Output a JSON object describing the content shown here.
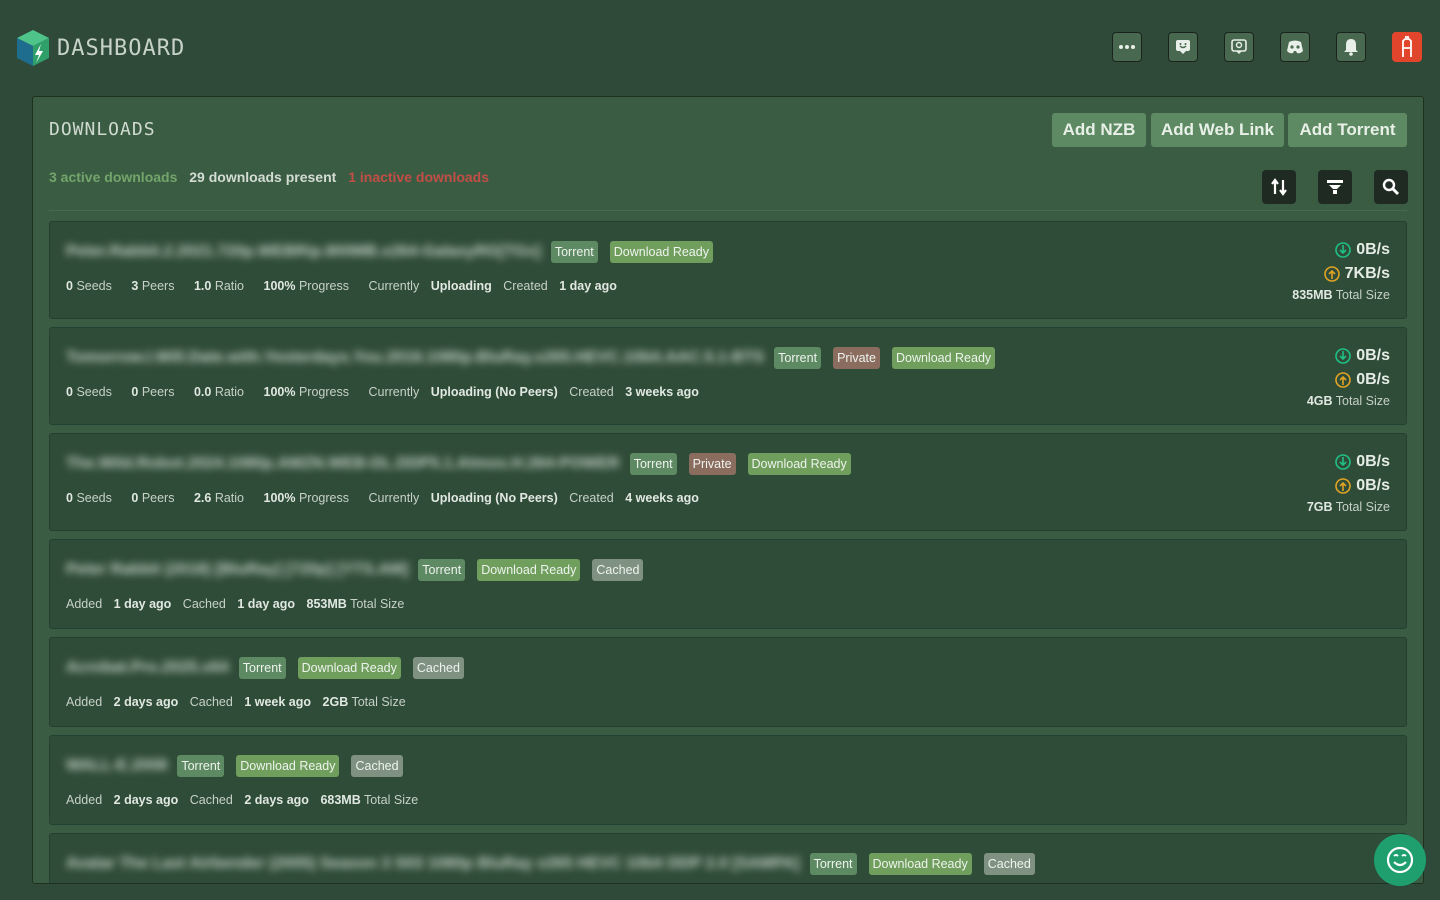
{
  "app": {
    "title": "DASHBOARD"
  },
  "header": {
    "buttons": [
      {
        "name": "more-icon"
      },
      {
        "name": "chat-bubble-icon"
      },
      {
        "name": "ideas-icon"
      },
      {
        "name": "discord-icon"
      },
      {
        "name": "bell-icon"
      },
      {
        "name": "avatar"
      }
    ]
  },
  "downloads": {
    "title": "DOWNLOADS",
    "add_nzb": "Add NZB",
    "add_web_link": "Add Web Link",
    "add_torrent": "Add Torrent",
    "summary": {
      "active": "3 active downloads",
      "present": "29 downloads present",
      "inactive": "1 inactive downloads"
    },
    "tools": [
      "sort-icon",
      "filter-icon",
      "search-icon"
    ],
    "items": [
      {
        "name": "Peter.Rabbit.2.2021.720p.WEBRip.800MB.x264-GalaxyRG[TGx]",
        "badges": [
          "Torrent",
          "Download Ready"
        ],
        "meta": {
          "seeds": "0",
          "seeds_label": "Seeds",
          "peers": "3",
          "peers_label": "Peers",
          "ratio": "1.0",
          "ratio_label": "Ratio",
          "progress": "100%",
          "progress_label": "Progress",
          "status_label": "Currently",
          "status": "Uploading",
          "created_label": "Created",
          "created": "1 day ago"
        },
        "down_speed": "0B/s",
        "up_speed": "7KB/s",
        "size": "835MB",
        "size_label": "Total Size"
      },
      {
        "name": "Tomorrow.I.Will.Date.with.Yesterdays.You.2016.1080p.BluRay.x265.HEVC.10bit.AAC.5.1-BTS",
        "badges": [
          "Torrent",
          "Private",
          "Download Ready"
        ],
        "meta": {
          "seeds": "0",
          "seeds_label": "Seeds",
          "peers": "0",
          "peers_label": "Peers",
          "ratio": "0.0",
          "ratio_label": "Ratio",
          "progress": "100%",
          "progress_label": "Progress",
          "status_label": "Currently",
          "status": "Uploading (No Peers)",
          "created_label": "Created",
          "created": "3 weeks ago"
        },
        "down_speed": "0B/s",
        "up_speed": "0B/s",
        "size": "4GB",
        "size_label": "Total Size"
      },
      {
        "name": "The.Wild.Robot.2024.1080p.AMZN.WEB-DL.DDP5.1.Atmos.H.264-POWER",
        "badges": [
          "Torrent",
          "Private",
          "Download Ready"
        ],
        "meta": {
          "seeds": "0",
          "seeds_label": "Seeds",
          "peers": "0",
          "peers_label": "Peers",
          "ratio": "2.6",
          "ratio_label": "Ratio",
          "progress": "100%",
          "progress_label": "Progress",
          "status_label": "Currently",
          "status": "Uploading (No Peers)",
          "created_label": "Created",
          "created": "4 weeks ago"
        },
        "down_speed": "0B/s",
        "up_speed": "0B/s",
        "size": "7GB",
        "size_label": "Total Size"
      },
      {
        "name": "Peter Rabbit (2018) [BluRay] [720p] [YTS.AM]",
        "badges": [
          "Torrent",
          "Download Ready",
          "Cached"
        ],
        "added_label": "Added",
        "added": "1 day ago",
        "cached_label": "Cached",
        "cached": "1 day ago",
        "size": "853MB",
        "size_label": "Total Size"
      },
      {
        "name": "Acrobat.Pro.2025.x64",
        "badges": [
          "Torrent",
          "Download Ready",
          "Cached"
        ],
        "added_label": "Added",
        "added": "2 days ago",
        "cached_label": "Cached",
        "cached": "1 week ago",
        "size": "2GB",
        "size_label": "Total Size"
      },
      {
        "name": "WALL-E.2008",
        "badges": [
          "Torrent",
          "Download Ready",
          "Cached"
        ],
        "added_label": "Added",
        "added": "2 days ago",
        "cached_label": "Cached",
        "cached": "2 days ago",
        "size": "683MB",
        "size_label": "Total Size"
      },
      {
        "name": "Avatar The Last Airbender (2005) Season 3 S03 1080p BluRay x265 HEVC 10bit DDP 2.0 [SAMPA]",
        "badges": [
          "Torrent",
          "Download Ready",
          "Cached"
        ]
      }
    ]
  },
  "colors": {
    "accent": "#5e8a63",
    "active": "#73a56b",
    "inactive": "#c24e46",
    "download_icon": "#1fbf85",
    "upload_icon": "#e0a325",
    "chat": "#1f9f6e"
  }
}
